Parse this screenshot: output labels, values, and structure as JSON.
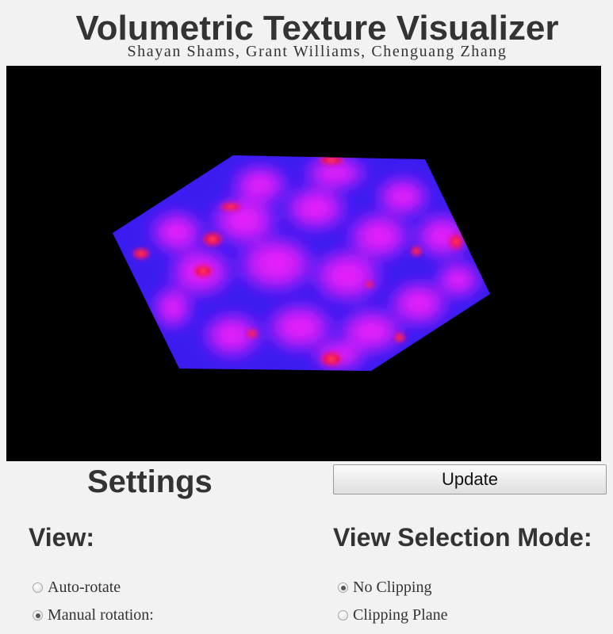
{
  "header": {
    "title": "Volumetric Texture Visualizer",
    "authors": "Shayan Shams, Grant Williams, Chenguang Zhang"
  },
  "viewport": {
    "background": "#000000",
    "volume_colors": {
      "base": "#2a1cf0",
      "blob": "#ff1aff",
      "core": "#ff1030"
    }
  },
  "settings": {
    "heading": "Settings",
    "update_label": "Update"
  },
  "view": {
    "heading": "View:",
    "options": [
      {
        "label": "Auto-rotate",
        "checked": false
      },
      {
        "label": "Manual rotation:",
        "checked": true
      }
    ]
  },
  "view_selection": {
    "heading": "View Selection Mode:",
    "options": [
      {
        "label": "No Clipping",
        "checked": true
      },
      {
        "label": "Clipping Plane",
        "checked": false
      }
    ]
  }
}
